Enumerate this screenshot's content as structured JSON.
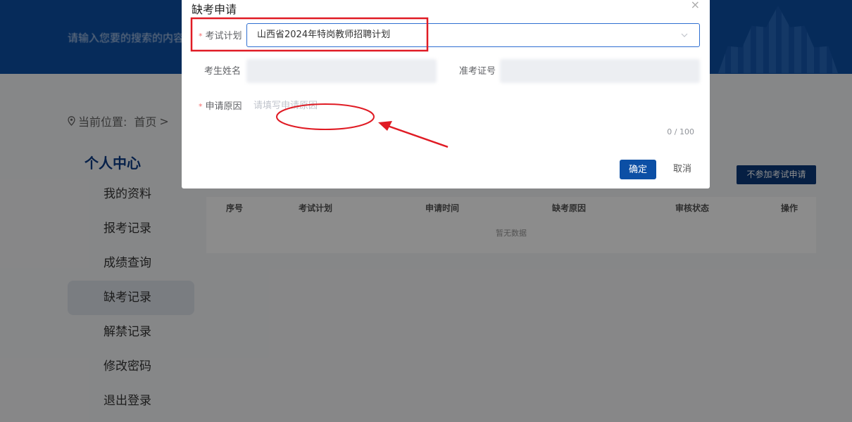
{
  "header": {
    "search_placeholder": "请输入您要的搜索的内容"
  },
  "breadcrumb": {
    "prefix": "当前位置:",
    "home": "首页",
    "sep": ">"
  },
  "sidebar": {
    "title": "个人中心",
    "items": [
      {
        "label": "我的资料"
      },
      {
        "label": "报考记录"
      },
      {
        "label": "成绩查询"
      },
      {
        "label": "缺考记录",
        "active": true
      },
      {
        "label": "解禁记录"
      },
      {
        "label": "修改密码"
      },
      {
        "label": "退出登录"
      }
    ]
  },
  "content": {
    "button_label": "不参加考试申请",
    "columns": [
      "序号",
      "考试计划",
      "申请时间",
      "缺考原因",
      "审核状态",
      "操作"
    ],
    "empty_text": "暂无数据"
  },
  "dialog": {
    "title": "缺考申请",
    "close_icon": "×",
    "exam_plan_label": "考试计划",
    "exam_plan_value": "山西省2024年特岗教师招聘计划",
    "name_label": "考生姓名",
    "ticket_label": "准考证号",
    "reason_label": "申请原因",
    "reason_placeholder": "请填写申请原因",
    "reason_count": "0 / 100",
    "ok_label": "确定",
    "cancel_label": "取消"
  },
  "colors": {
    "primary": "#0c4fa5",
    "annotation_red": "#e01b24"
  }
}
